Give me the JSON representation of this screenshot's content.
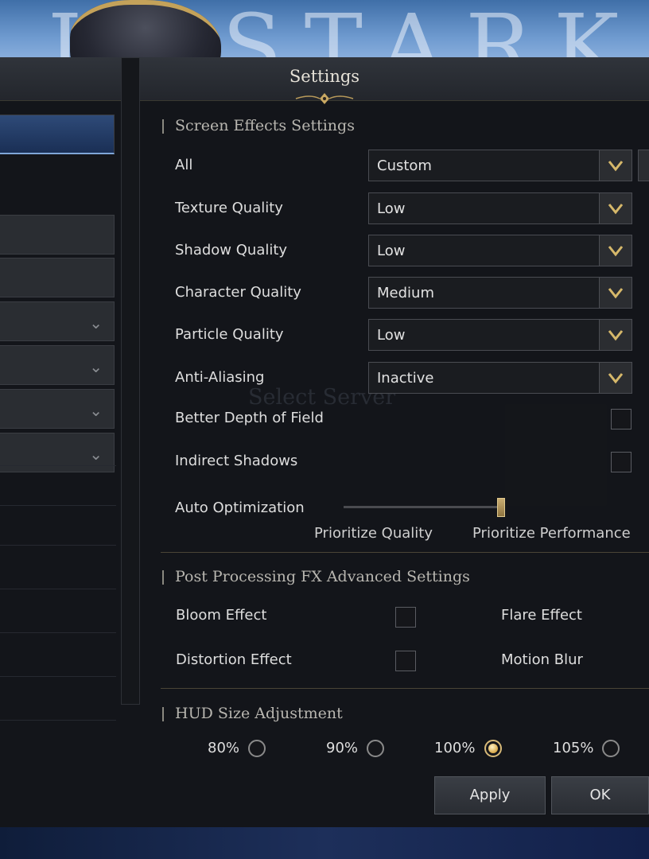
{
  "dialog": {
    "title": "Settings",
    "background_logo_text": "LOSTARK"
  },
  "screen_effects": {
    "section_title": "Screen Effects Settings",
    "rows": [
      {
        "label": "All",
        "value": "Custom"
      },
      {
        "label": "Texture Quality",
        "value": "Low"
      },
      {
        "label": "Shadow Quality",
        "value": "Low"
      },
      {
        "label": "Character Quality",
        "value": "Medium"
      },
      {
        "label": "Particle Quality",
        "value": "Low"
      },
      {
        "label": "Anti-Aliasing",
        "value": "Inactive"
      }
    ],
    "checkboxes": [
      {
        "label": "Better Depth of Field",
        "checked": false
      },
      {
        "label": "Indirect Shadows",
        "checked": false
      }
    ],
    "auto_optimization": {
      "label": "Auto Optimization",
      "left_label": "Prioritize Quality",
      "right_label": "Prioritize Performance",
      "level": 1.0
    }
  },
  "post_processing": {
    "section_title": "Post Processing FX Advanced Settings",
    "items": [
      {
        "label": "Bloom Effect",
        "checked": false
      },
      {
        "label": "Flare Effect"
      },
      {
        "label": "Distortion Effect",
        "checked": false
      },
      {
        "label": "Motion Blur"
      }
    ]
  },
  "hud": {
    "section_title": "HUD Size Adjustment",
    "options": [
      {
        "label": "80%",
        "selected": false
      },
      {
        "label": "90%",
        "selected": false
      },
      {
        "label": "100%",
        "selected": true
      },
      {
        "label": "105%",
        "selected": false
      }
    ]
  },
  "footer": {
    "apply_label": "Apply",
    "ok_label": "OK"
  },
  "background_text": {
    "select_server": "Select Server"
  },
  "colors": {
    "accent_gold": "#d7b978",
    "active_nav": "#2e4a78"
  }
}
